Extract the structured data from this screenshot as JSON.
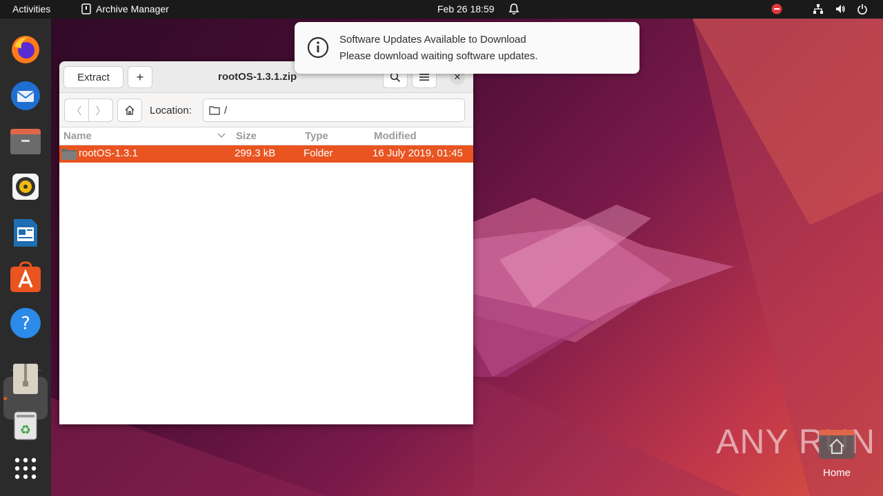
{
  "topbar": {
    "activities": "Activities",
    "app_name": "Archive Manager",
    "clock": "Feb 26  18:59"
  },
  "window": {
    "title": "rootOS-1.3.1.zip",
    "extract_label": "Extract",
    "add_label": "+",
    "location_label": "Location:",
    "location_value": "/",
    "columns": {
      "name": "Name",
      "size": "Size",
      "type": "Type",
      "modified": "Modified"
    },
    "rows": [
      {
        "name": "rootOS-1.3.1",
        "size": "299.3 kB",
        "type": "Folder",
        "modified": "16 July 2019, 01:45"
      }
    ]
  },
  "notification": {
    "title": "Software Updates Available to Download",
    "body": "Please download waiting software updates."
  },
  "desktop": {
    "home_label": "Home",
    "watermark": "ANY RUN"
  },
  "colors": {
    "accent": "#e95420",
    "topbar": "#1a1a1a",
    "dock": "#2b2b2b"
  },
  "dock_icons": [
    "firefox-icon",
    "thunderbird-icon",
    "files-icon",
    "rhythmbox-icon",
    "writer-icon",
    "software-icon",
    "help-icon",
    "archive-manager-icon",
    "trash-icon",
    "app-grid-icon"
  ]
}
